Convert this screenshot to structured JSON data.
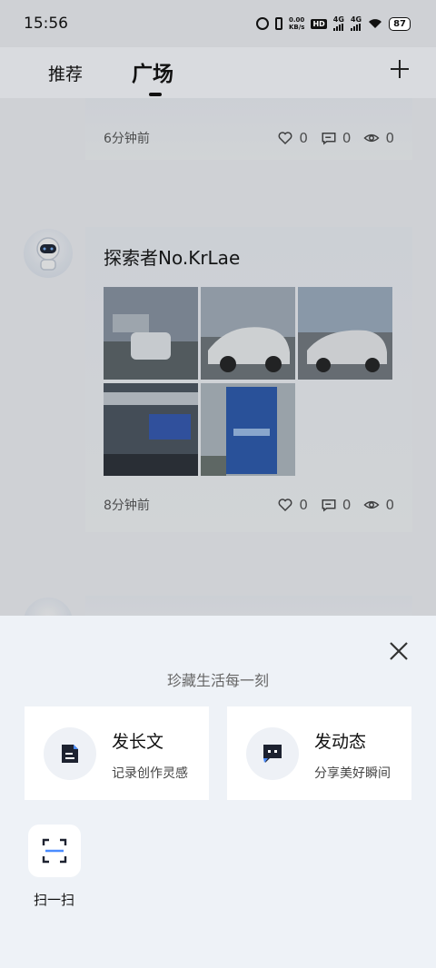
{
  "status_bar": {
    "time": "15:56",
    "speed_top": "0.00",
    "speed_bottom": "KB/s",
    "hd": "HD",
    "net1": "4G",
    "net2": "4G",
    "battery": "87"
  },
  "header": {
    "tabs": [
      {
        "label": "推荐",
        "active": false
      },
      {
        "label": "广场",
        "active": true
      }
    ],
    "add_icon": "plus-icon"
  },
  "feed": {
    "posts": [
      {
        "time": "6分钟前",
        "likes": "0",
        "comments": "0",
        "views": "0"
      },
      {
        "author": "探索者No.KrLae",
        "time": "8分钟前",
        "likes": "0",
        "comments": "0",
        "views": "0",
        "image_count": 5
      }
    ]
  },
  "sheet": {
    "title": "珍藏生活每一刻",
    "options": [
      {
        "title": "发长文",
        "subtitle": "记录创作灵感",
        "icon": "article-icon"
      },
      {
        "title": "发动态",
        "subtitle": "分享美好瞬间",
        "icon": "moment-icon"
      }
    ],
    "scan_label": "扫一扫",
    "close_icon": "close-icon"
  },
  "colors": {
    "sheet_bg": "#eef2f7",
    "card_bg": "#ffffff",
    "text_primary": "#111111",
    "text_secondary": "#666666"
  }
}
